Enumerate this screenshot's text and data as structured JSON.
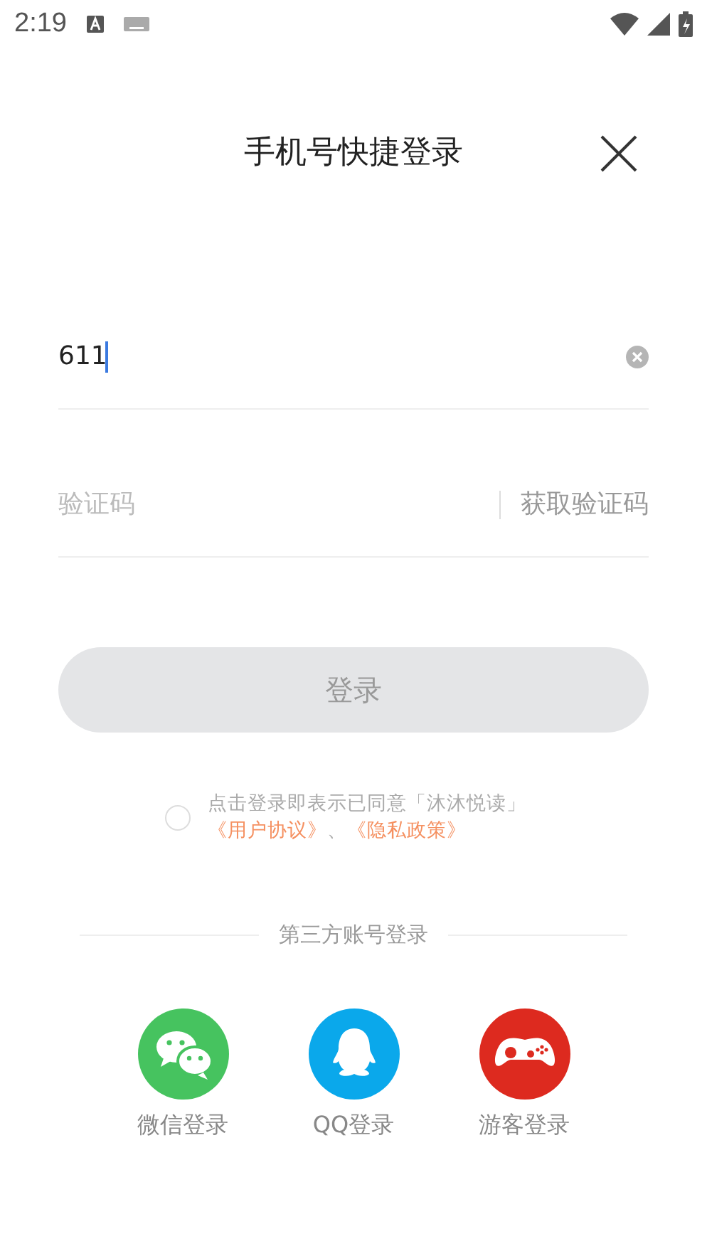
{
  "status_bar": {
    "time": "2:19"
  },
  "header": {
    "title": "手机号快捷登录"
  },
  "phone_field": {
    "value": "611",
    "focused": true
  },
  "code_field": {
    "placeholder": "验证码",
    "button": "获取验证码"
  },
  "login_button": {
    "label": "登录",
    "disabled": true
  },
  "agreement": {
    "checked": false,
    "text": "点击登录即表示已同意「沐沐悦读」",
    "links": [
      "《用户协议》",
      "《隐私政策》"
    ],
    "separator": "、"
  },
  "third_party": {
    "heading": "第三方账号登录",
    "options": [
      {
        "kind": "wechat",
        "label": "微信登录"
      },
      {
        "kind": "qq",
        "label": "QQ登录"
      },
      {
        "kind": "guest",
        "label": "游客登录"
      }
    ]
  }
}
